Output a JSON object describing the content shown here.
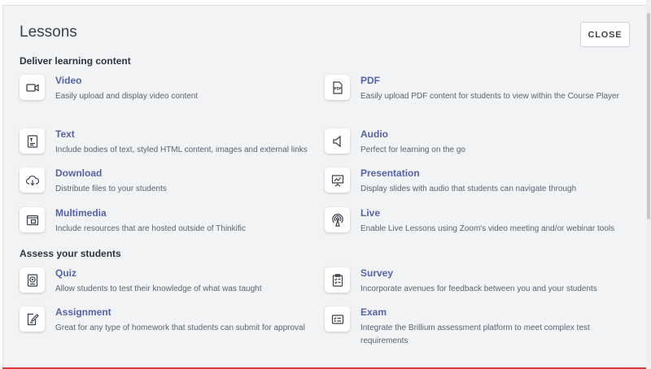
{
  "modal": {
    "title": "Lessons",
    "close_label": "CLOSE"
  },
  "sections": {
    "deliver": "Deliver learning content",
    "assess": "Assess your students"
  },
  "items": {
    "video": {
      "title": "Video",
      "desc": "Easily upload and display video content",
      "icon": "video-camera-icon"
    },
    "pdf": {
      "title": "PDF",
      "desc": "Easily upload PDF content for students to view within the Course Player",
      "icon": "pdf-file-icon"
    },
    "text": {
      "title": "Text",
      "desc": "Include bodies of text, styled HTML content, images and external links",
      "icon": "text-document-icon"
    },
    "audio": {
      "title": "Audio",
      "desc": "Perfect for learning on the go",
      "icon": "speaker-icon"
    },
    "download": {
      "title": "Download",
      "desc": "Distribute files to your students",
      "icon": "cloud-download-icon"
    },
    "presentation": {
      "title": "Presentation",
      "desc": "Display slides with audio that students can navigate through",
      "icon": "presentation-board-icon"
    },
    "multimedia": {
      "title": "Multimedia",
      "desc": "Include resources that are hosted outside of Thinkific",
      "icon": "multimedia-window-icon"
    },
    "live": {
      "title": "Live",
      "desc": "Enable Live Lessons using Zoom's video meeting and/or webinar tools",
      "icon": "broadcast-icon"
    },
    "quiz": {
      "title": "Quiz",
      "desc": "Allow students to test their knowledge of what was taught",
      "icon": "quiz-icon"
    },
    "survey": {
      "title": "Survey",
      "desc": "Incorporate avenues for feedback between you and your students",
      "icon": "clipboard-checklist-icon"
    },
    "assignment": {
      "title": "Assignment",
      "desc": "Great for any type of homework that students can submit for approval",
      "icon": "assignment-edit-icon"
    },
    "exam": {
      "title": "Exam",
      "desc": "Integrate the Brillium assessment platform to meet complex test requirements",
      "icon": "exam-checklist-icon"
    }
  },
  "colors": {
    "accent": "#5563a8",
    "modal_bg": "#f2f3f5",
    "bottom_bar": "#d93a3a"
  }
}
